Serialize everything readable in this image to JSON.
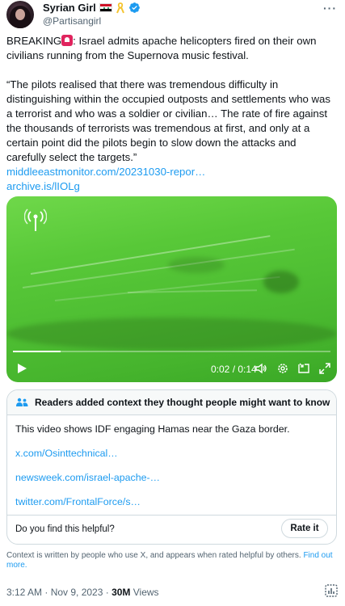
{
  "author": {
    "display_name": "Syrian Girl",
    "handle": "@Partisangirl",
    "more_menu": "···"
  },
  "tweet": {
    "breaking_label": "BREAKING",
    "line1_rest": ": Israel admits apache helicopters fired on their own civilians running from the Supernova music festival.",
    "quote": "“The pilots realised that there was tremendous difficulty in distinguishing within the occupied outposts and settlements who was a terrorist and who was a soldier or civilian… The rate of fire against the thousands of terrorists was tremendous at first, and only at a certain point did the pilots begin to slow down the attacks and carefully select the targets.”",
    "link1": "middleeastmonitor.com/20231030-repor…",
    "link2": "archive.is/lIOLg"
  },
  "video": {
    "time": "0:02 / 0:14",
    "progress_fraction": 0.15
  },
  "community_note": {
    "title": "Readers added context they thought people might want to know",
    "body": "This video shows IDF engaging Hamas near the Gaza border.",
    "links": [
      "x.com/Osinttechnical…",
      "newsweek.com/israel-apache-…",
      "twitter.com/FrontalForce/s…"
    ],
    "helpful_prompt": "Do you find this helpful?",
    "rate_button": "Rate it"
  },
  "context_footer": {
    "text": "Context is written by people who use X, and appears when rated helpful by others.",
    "link": "Find out more."
  },
  "meta": {
    "timestamp": "3:12 AM · Nov 9, 2023 · ",
    "views_count": "30M",
    "views_label": " Views"
  },
  "colors": {
    "accent": "#1d9bf0",
    "text": "#0f1419",
    "secondary": "#536471",
    "border": "#cfd9de",
    "video_green": "#58c838"
  },
  "icons": [
    "more-icon",
    "flag-icon",
    "ribbon-icon",
    "verified-icon",
    "alarm-emoji-icon",
    "antenna-icon",
    "play-icon",
    "volume-icon",
    "settings-icon",
    "pip-icon",
    "fullscreen-icon",
    "people-icon",
    "analytics-icon"
  ]
}
